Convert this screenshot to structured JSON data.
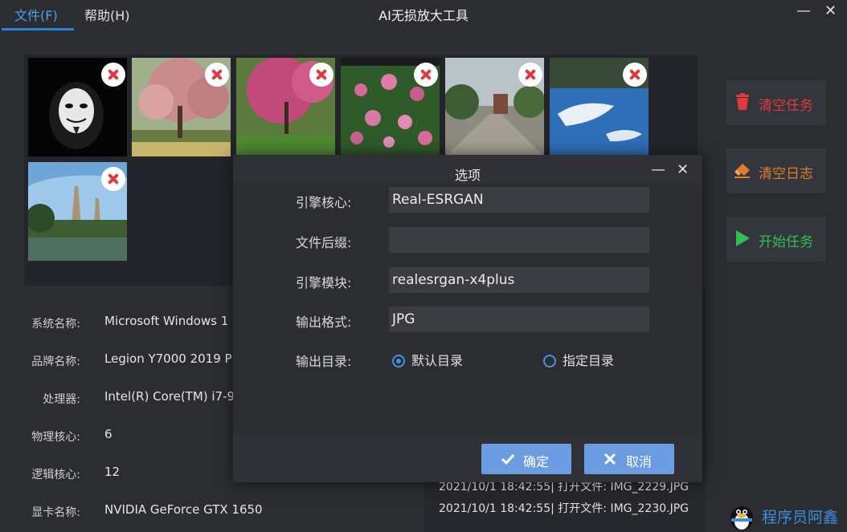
{
  "menu": {
    "file": "文件(F)",
    "help": "帮助(H)"
  },
  "app_title": "AI无损放大工具",
  "window": {
    "minimize": "—",
    "close": "✕"
  },
  "actions": {
    "clear_tasks": "清空任务",
    "clear_log": "清空日志",
    "start_tasks": "开始任务"
  },
  "colors": {
    "accent": "#2f7fd8",
    "danger": "#e0393e",
    "warning": "#e07c2a",
    "success": "#2fbf55",
    "button": "#6b9be0"
  },
  "system_info": [
    {
      "label": "系统名称:",
      "value": "Microsoft Windows 1"
    },
    {
      "label": "品牌名称:",
      "value": "Legion Y7000 2019 P"
    },
    {
      "label": "处理器:",
      "value": "Intel(R) Core(TM) i7-9"
    },
    {
      "label": "物理核心:",
      "value": "6"
    },
    {
      "label": "逻辑核心:",
      "value": "12"
    },
    {
      "label": "显卡名称:",
      "value": "NVIDIA GeForce GTX 1650"
    }
  ],
  "log": [
    "2021/10/1 18:42:55| 打开文件: IMG_2229.JPG",
    "2021/10/1 18:42:55| 打开文件: IMG_2230.JPG"
  ],
  "dialog": {
    "title": "选项",
    "engine_core_label": "引擎核心:",
    "engine_core_value": "Real-ESRGAN",
    "file_suffix_label": "文件后缀:",
    "file_suffix_value": "",
    "engine_model_label": "引擎模块:",
    "engine_model_value": "realesrgan-x4plus",
    "output_format_label": "输出格式:",
    "output_format_value": "JPG",
    "output_dir_label": "输出目录:",
    "radio_default": "默认目录",
    "radio_custom": "指定目录",
    "confirm": "确定",
    "cancel": "取消",
    "minimize": "—",
    "close": "✕"
  },
  "thumbnails": [
    {
      "name": "anonymous-mask"
    },
    {
      "name": "blossom-tree"
    },
    {
      "name": "pink-tree"
    },
    {
      "name": "flowers"
    },
    {
      "name": "street"
    },
    {
      "name": "sky-water"
    },
    {
      "name": "pagodas-lake"
    }
  ],
  "watermark": "程序员阿鑫"
}
